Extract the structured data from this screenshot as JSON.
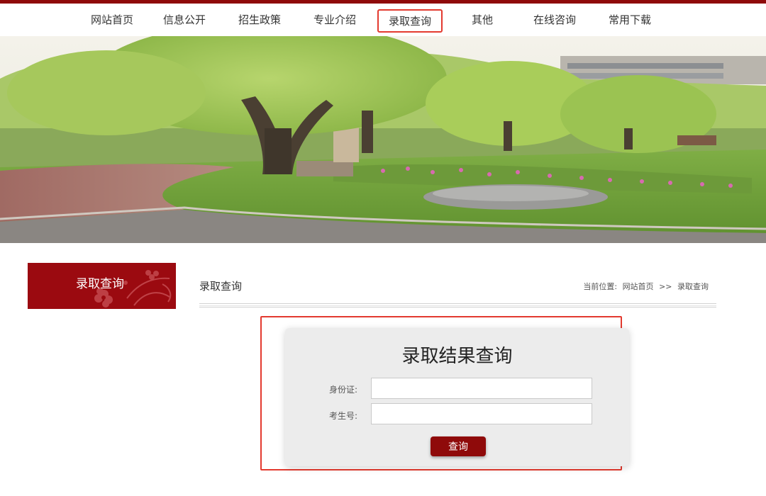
{
  "nav": {
    "items": [
      {
        "label": "网站首页"
      },
      {
        "label": "信息公开"
      },
      {
        "label": "招生政策"
      },
      {
        "label": "专业介绍"
      },
      {
        "label": "录取查询",
        "active": true
      },
      {
        "label": "其他"
      },
      {
        "label": "在线咨询"
      },
      {
        "label": "常用下载"
      }
    ]
  },
  "sidebar": {
    "title": "录取查询"
  },
  "content": {
    "title": "录取查询",
    "breadcrumb": {
      "prefix": "当前位置:",
      "home": "网站首页",
      "separator": ">>",
      "current": "录取查询"
    }
  },
  "query_form": {
    "heading": "录取结果查询",
    "id_label": "身份证:",
    "id_value": "",
    "exam_label": "考生号:",
    "exam_value": "",
    "submit_label": "查询"
  },
  "colors": {
    "brand": "#8f0a0a",
    "highlight": "#e33a2f",
    "card": "#ececec"
  }
}
